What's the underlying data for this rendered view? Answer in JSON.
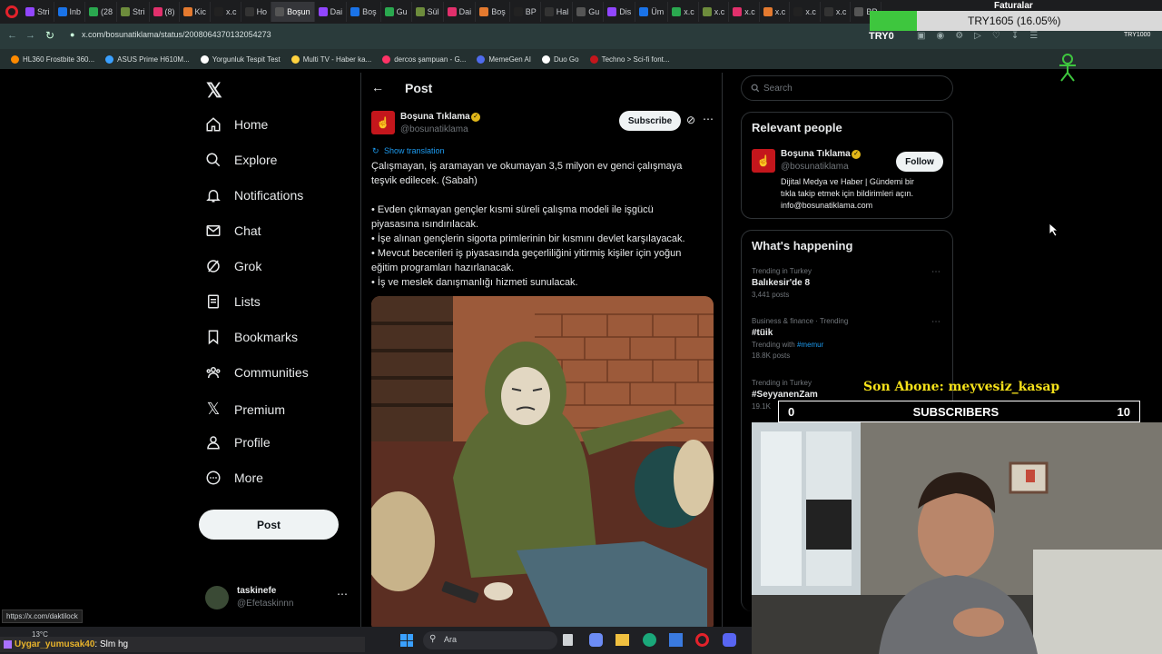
{
  "browser": {
    "tabs": [
      "Stri",
      "Inb",
      "(28",
      "Stri",
      "(8)",
      "Kic",
      "x.c",
      "Ho",
      "Boşun",
      "Dai",
      "Boş",
      "Gu",
      "Sül",
      "Dai",
      "Boş",
      "BP",
      "Hal",
      "Gu",
      "Dis",
      "Üm",
      "x.c",
      "x.c",
      "x.c",
      "x.c",
      "x.c",
      "x.c",
      "BP"
    ],
    "url": "x.com/bosunatiklama/status/2008064370132054273",
    "bookmarks": [
      "HL360 Frostbite 360...",
      "ASUS Prime H610M...",
      "Yorgunluk Tespit Test",
      "Multi TV - Haber ka...",
      "dercos şampuan - G...",
      "MemeGen AI",
      "Duo Go",
      "Techno > Sci-fi font..."
    ],
    "status_url": "https://x.com/daktilock"
  },
  "overlay": {
    "faturalar": "Faturalar",
    "currency_label": "TRY1605 (16.05%)",
    "try0": "TRY0",
    "try_small": "TRY1000",
    "son_abone": "Son Abone: meyvesiz_kasap",
    "subs_left": "0",
    "subs_title": "SUBSCRIBERS",
    "subs_right": "10"
  },
  "nav": {
    "items": [
      "Home",
      "Explore",
      "Notifications",
      "Chat",
      "Grok",
      "Lists",
      "Bookmarks",
      "Communities",
      "Premium",
      "Profile",
      "More"
    ],
    "post_button": "Post",
    "account_name": "taskinefe",
    "account_handle": "@Efetaskinnn"
  },
  "post": {
    "header": "Post",
    "author_name": "Boşuna Tıklama",
    "author_handle": "@bosunatiklama",
    "subscribe": "Subscribe",
    "show_translation": "Show translation",
    "text_lines": [
      "Çalışmayan, iş aramayan ve okumayan 3,5 milyon ev genci çalışmaya",
      "teşvik edilecek. (Sabah)",
      "",
      "• Evden çıkmayan gençler kısmi süreli çalışma modeli ile işgücü",
      "piyasasına ısındırılacak.",
      "• İşe alınan gençlerin sigorta primlerinin bir kısmını devlet karşılayacak.",
      "• Mevcut becerileri iş piyasasında geçerliliğini yitirmiş kişiler için yoğun",
      "eğitim programları hazırlanacak.",
      "• İş ve meslek danışmanlığı hizmeti sunulacak."
    ]
  },
  "right": {
    "search_placeholder": "Search",
    "relevant_title": "Relevant people",
    "person_name": "Boşuna Tıklama",
    "person_handle": "@bosunatiklama",
    "follow": "Follow",
    "bio": [
      "Dijital Medya ve Haber | Gündemi bir",
      "tıkla takip etmek için bildirimleri açın.",
      "info@bosunatiklama.com"
    ],
    "happening_title": "What's happening",
    "trends": [
      {
        "category": "Trending in Turkey",
        "name": "Balıkesir'de 8",
        "extra": "",
        "count": "3,441 posts"
      },
      {
        "category": "Business & finance · Trending",
        "name": "#tüik",
        "extra": "Trending with #memur",
        "count": "18.8K posts"
      },
      {
        "category": "Trending in Turkey",
        "name": "#SeyyanenZam",
        "extra": "",
        "count": "19.1K"
      }
    ]
  },
  "taskbar": {
    "weather": "13°C",
    "search": "Ara",
    "chat_user": "Uygar_yumusak40",
    "chat_message": ": Slm hg"
  },
  "colors": {
    "accent": "#1d9bf0",
    "verified_gold": "#e2b719",
    "brand_red": "#c4161c"
  }
}
